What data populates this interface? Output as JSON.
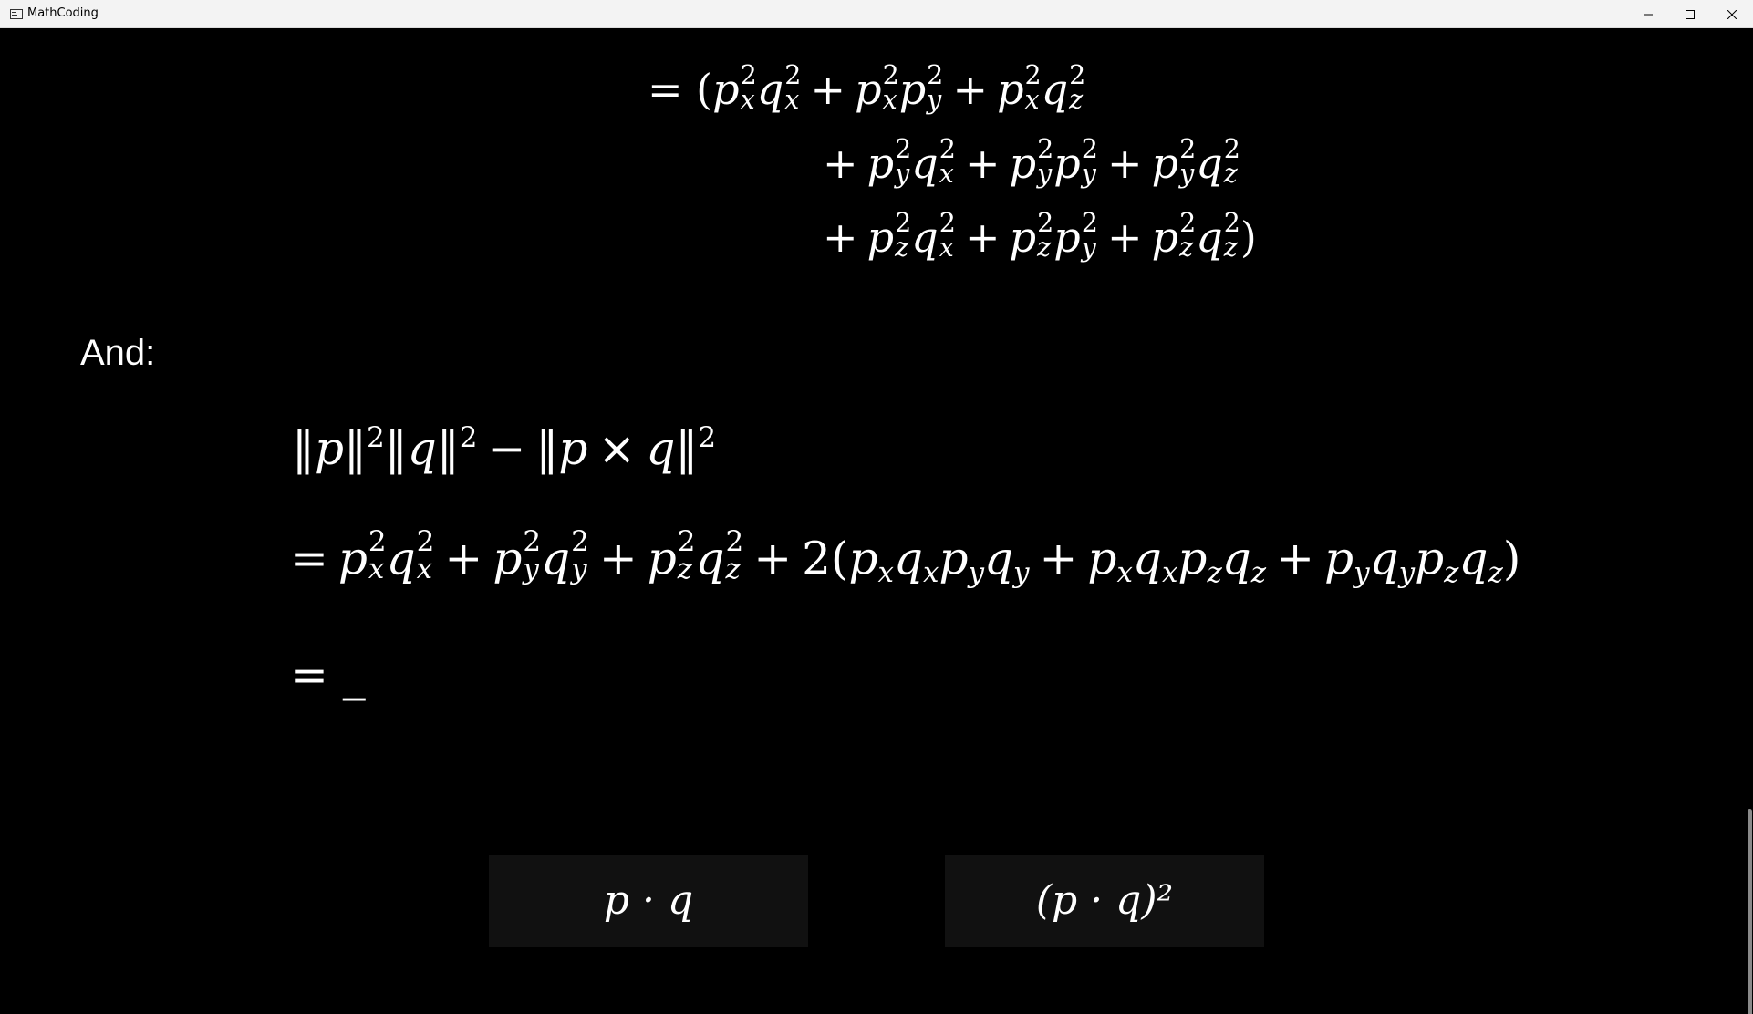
{
  "window": {
    "title": "MathCoding",
    "minimize_icon": "minimize-icon",
    "maximize_icon": "maximize-icon",
    "close_icon": "close-icon"
  },
  "content": {
    "and_label": "And:",
    "expansion": {
      "line1_start": "= (",
      "line3_end": ")"
    },
    "expression": {
      "lhs": "‖p‖²‖q‖² − ‖p × q‖²",
      "expanded": "= p_x²q_x² + p_y²q_y² + p_z²q_z² + 2(p_x q_x p_y q_y + p_x q_x p_z q_z + p_y q_y p_z q_z)",
      "result_prompt": "= _"
    },
    "choices": [
      {
        "label": "p · q"
      },
      {
        "label": "(p · q)²"
      }
    ]
  },
  "colors": {
    "background": "#000000",
    "text": "#ffffff",
    "button_bg": "#111111",
    "titlebar_bg": "#f3f3f3"
  }
}
